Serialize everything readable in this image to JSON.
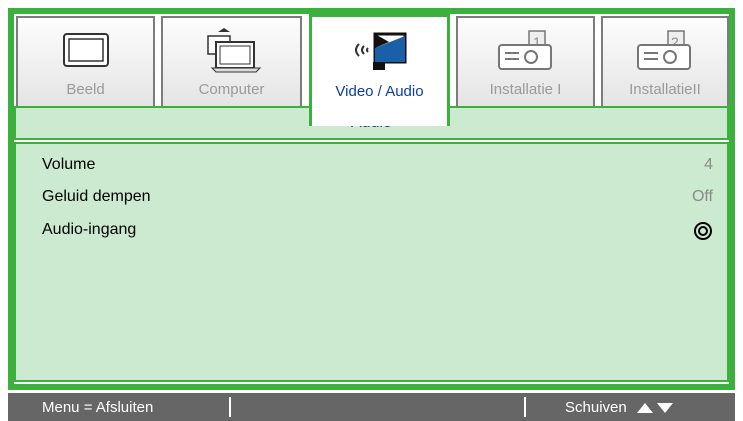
{
  "tabs": [
    {
      "label": "Beeld",
      "icon": "monitor-icon"
    },
    {
      "label": "Computer",
      "icon": "computer-icon"
    },
    {
      "label": "Video / Audio",
      "icon": "video-audio-icon",
      "active": true
    },
    {
      "label": "Installatie I",
      "icon": "projector-1-icon"
    },
    {
      "label": "InstallatieII",
      "icon": "projector-2-icon"
    }
  ],
  "panel": {
    "title": "Audio",
    "rows": [
      {
        "name": "Volume",
        "value": "4"
      },
      {
        "name": "Geluid dempen",
        "value": "Off"
      },
      {
        "name": "Audio-ingang",
        "icon": "enter-submenu-icon"
      }
    ]
  },
  "footer": {
    "left": "Menu = Afsluiten",
    "right": "Schuiven"
  },
  "colors": {
    "accent_green": "#3bb03d",
    "panel_bg": "#ccead0",
    "active_text_blue": "#0a3da8",
    "footer_bg": "#666666"
  }
}
